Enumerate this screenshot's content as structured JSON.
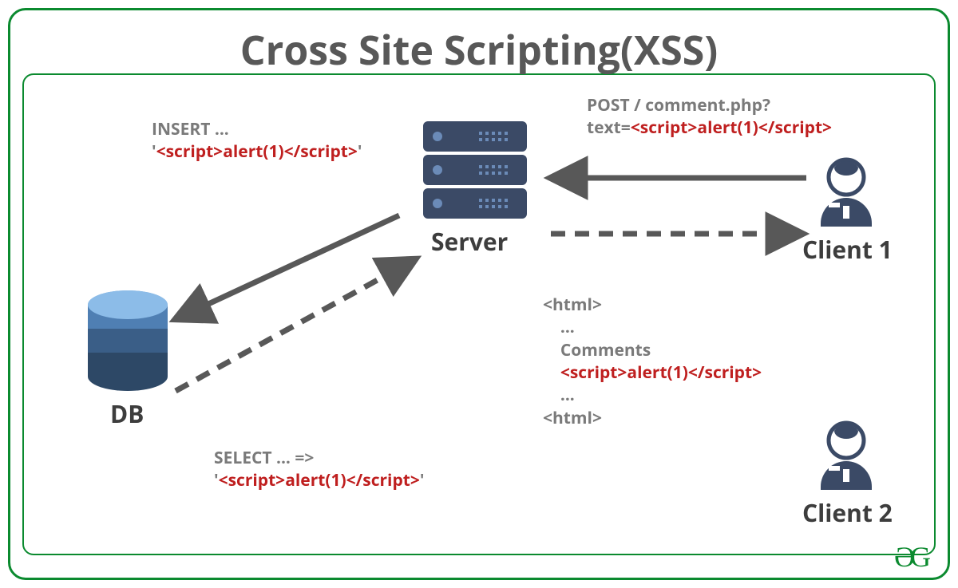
{
  "title": "Cross Site Scripting(XSS)",
  "nodes": {
    "db": {
      "label": "DB"
    },
    "server": {
      "label": "Server"
    },
    "client1": {
      "label": "Client 1"
    },
    "client2": {
      "label": "Client 2"
    }
  },
  "flows": {
    "client1_to_server": {
      "line1": "POST / comment.php?",
      "line2_prefix": "text=",
      "line2_payload": "<script>alert(1)</script>"
    },
    "server_to_db": {
      "line1": "INSERT ...",
      "line2_quote_open": "'",
      "line2_payload": "<script>alert(1)</script>",
      "line2_quote_close": "'"
    },
    "db_to_server": {
      "line1": "SELECT ... =>",
      "line2_quote_open": "'",
      "line2_payload": "<script>alert(1)</script>",
      "line2_quote_close": "'"
    },
    "server_to_client2": {
      "html_open": "<html>",
      "dots1": "...",
      "comments": "Comments",
      "payload": "<script>alert(1)</script>",
      "dots2": "...",
      "html_close": "<html>"
    }
  },
  "logo": "ƏG"
}
